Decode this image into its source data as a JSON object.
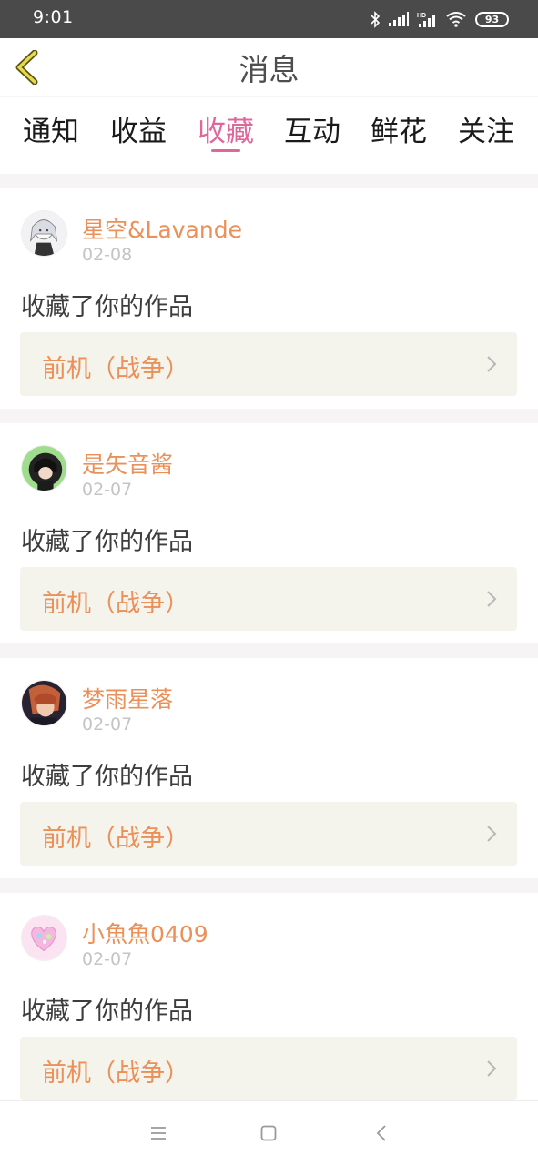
{
  "status_bar": {
    "time": "9:01",
    "battery": "93",
    "icons": [
      "bluetooth-icon",
      "signal-icon",
      "hd-signal-icon",
      "wifi-icon",
      "battery-icon"
    ]
  },
  "header": {
    "title": "消息",
    "back_icon": "chevron-left-icon"
  },
  "tabs": [
    {
      "label": "通知",
      "active": false
    },
    {
      "label": "收益",
      "active": false
    },
    {
      "label": "收藏",
      "active": true
    },
    {
      "label": "互动",
      "active": false
    },
    {
      "label": "鲜花",
      "active": false
    },
    {
      "label": "关注",
      "active": false
    }
  ],
  "notifications": [
    {
      "user": "星空&Lavande",
      "date": "02-08",
      "action": "收藏了你的作品",
      "work": "前机（战争）"
    },
    {
      "user": "是矢音酱",
      "date": "02-07",
      "action": "收藏了你的作品",
      "work": "前机（战争）"
    },
    {
      "user": "梦雨星落",
      "date": "02-07",
      "action": "收藏了你的作品",
      "work": "前机（战争）"
    },
    {
      "user": "小魚魚0409",
      "date": "02-07",
      "action": "收藏了你的作品",
      "work": "前机（战争）"
    }
  ],
  "nav_bar": {
    "icons": [
      "menu-icon",
      "home-square-icon",
      "back-triangle-icon"
    ]
  },
  "colors": {
    "accent": "#e0679c",
    "username": "#ea9058",
    "work_bg": "#f4f3ec",
    "back_icon": "#c9bd3a"
  }
}
